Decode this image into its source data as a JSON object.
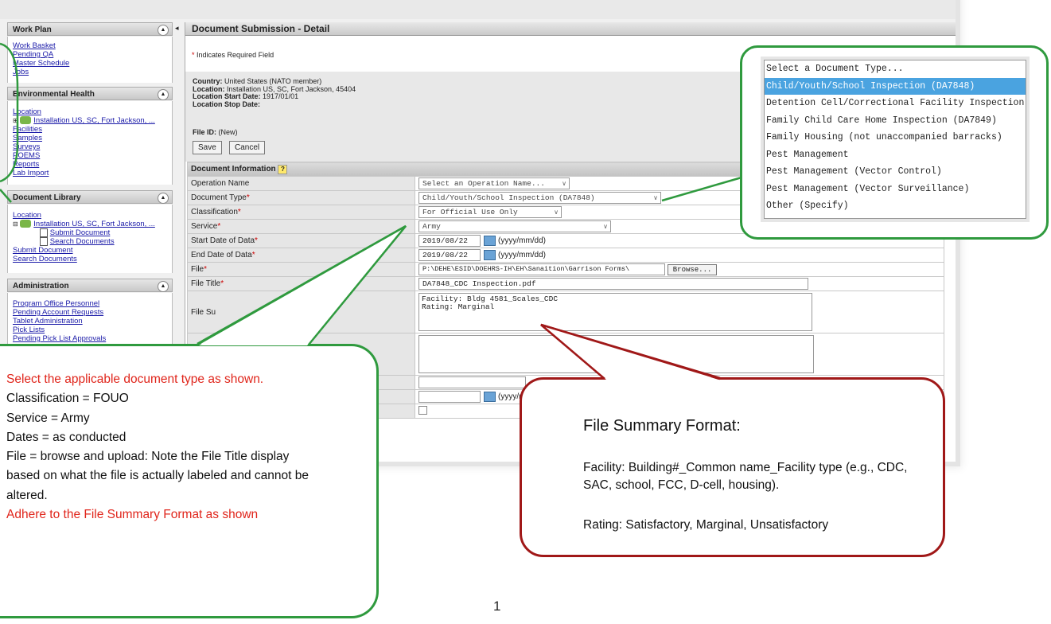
{
  "sidebar": {
    "work_plan": {
      "title": "Work Plan",
      "links": [
        "Work Basket",
        "Pending QA",
        "Master Schedule",
        "Jobs"
      ]
    },
    "environmental_health": {
      "title": "Environmental Health",
      "location": "Location",
      "tree_node": "Installation US, SC, Fort Jackson, ...",
      "links": [
        "Facilities",
        "Samples",
        "Surveys",
        "POEMS",
        "Reports",
        "Lab Import"
      ]
    },
    "document_library": {
      "title": "Document Library",
      "location": "Location",
      "tree_node": "Installation US, SC, Fort Jackson, ...",
      "tree_children": [
        "Submit Document",
        "Search Documents"
      ],
      "links": [
        "Submit Document",
        "Search Documents"
      ]
    },
    "administration": {
      "title": "Administration",
      "links": [
        "Program Office Personnel",
        "Pending Account Requests",
        "Tablet Administration",
        "Pick Lists",
        "Pending Pick List Approvals"
      ]
    }
  },
  "main": {
    "title": "Document Submission - Detail",
    "required_note_star": "*",
    "required_note": "Indicates Required Field",
    "info": [
      {
        "label": "Country:",
        "value": "United States (NATO member)"
      },
      {
        "label": "Location:",
        "value": "Installation US, SC, Fort Jackson, 45404"
      },
      {
        "label": "Location Start Date:",
        "value": "1917/01/01"
      },
      {
        "label": "Location Stop Date:",
        "value": ""
      }
    ],
    "file_id_label": "File ID:",
    "file_id_value": "(New)",
    "save_label": "Save",
    "cancel_label": "Cancel",
    "section_title": "Document Information",
    "help_icon": "?",
    "fields": {
      "operation_name": {
        "label": "Operation Name",
        "value": "Select an Operation Name..."
      },
      "document_type": {
        "label": "Document Type",
        "value": "Child/Youth/School Inspection (DA7848)"
      },
      "classification": {
        "label": "Classification",
        "value": "For Official Use Only"
      },
      "service": {
        "label": "Service",
        "value": "Army"
      },
      "start_date": {
        "label": "Start Date of Data",
        "value": "2019/08/22",
        "format": "(yyyy/mm/dd)"
      },
      "end_date": {
        "label": "End Date of Data",
        "value": "2019/08/22",
        "format": "(yyyy/mm/dd)"
      },
      "file": {
        "label": "File",
        "value": "P:\\DEHE\\ESID\\DOEHRS-IH\\EH\\Sanaition\\Garrison Forms\\",
        "browse": "Browse..."
      },
      "file_title": {
        "label": "File Title",
        "value": "DA7848_CDC Inspection.pdf"
      },
      "file_summary": {
        "label": "File Su",
        "line1": "Facility: Bldg 4581_Scales_CDC",
        "line2": "Rating: Marginal"
      },
      "partial_date_format": "(yyyy/m"
    }
  },
  "dropdown": {
    "options": [
      "Select a Document Type...",
      "Child/Youth/School Inspection (DA7848)",
      "Detention Cell/Correctional Facility Inspection",
      "Family Child Care Home Inspection (DA7849)",
      "Family Housing (not unaccompanied barracks)",
      "Pest Management",
      "Pest Management (Vector Control)",
      "Pest Management (Vector Surveillance)",
      "Other (Specify)"
    ],
    "highlighted_index": 1
  },
  "green_callout": {
    "line1": "Select the applicable document type as shown.",
    "line2": "Classification = FOUO",
    "line3": "Service = Army",
    "line4": "Dates = as conducted",
    "line5": "File = browse and upload: Note the File Title display based on what the file is actually labeled and cannot be altered.",
    "line6": "Adhere to the File Summary Format as shown"
  },
  "red_callout": {
    "heading": "File Summary Format:",
    "facility_line": "Facility: Building#_Common name_Facility type (e.g., CDC, SAC, school, FCC, D-cell, housing).",
    "rating_line": "Rating: Satisfactory, Marginal, Unsatisfactory"
  },
  "page_number": "1",
  "colors": {
    "green": "#2f9a3e",
    "red_border": "#a01818",
    "red_text": "#e0251b",
    "highlight": "#4aa3e0",
    "link": "#1a1aa8"
  }
}
